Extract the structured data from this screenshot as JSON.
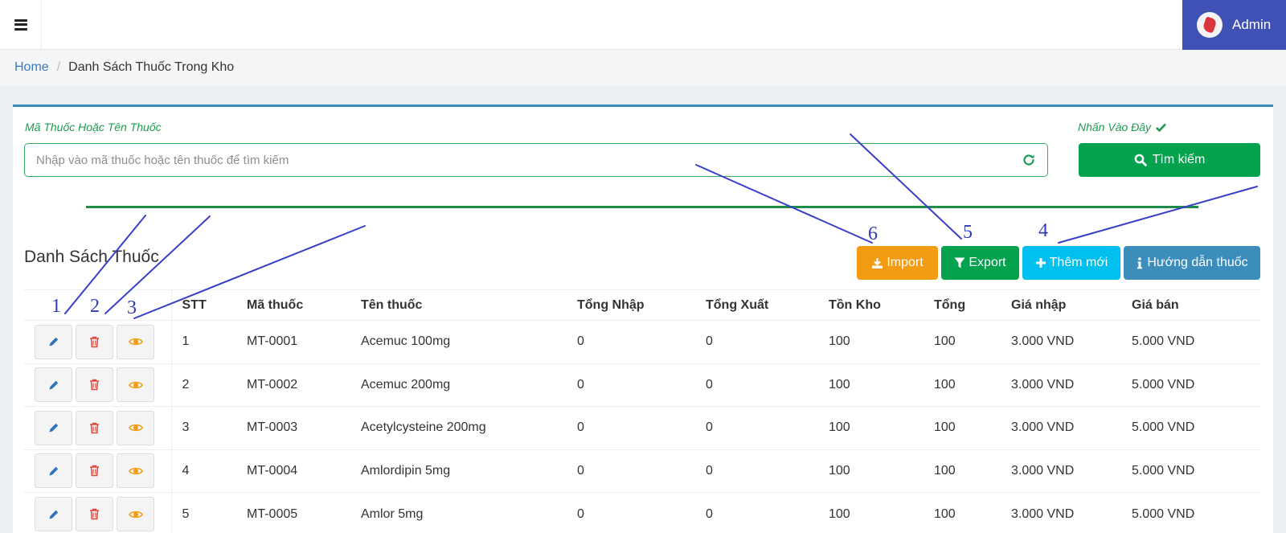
{
  "topbar": {
    "menu_icon": "hamburger-icon",
    "user_name": "Admin"
  },
  "breadcrumb": {
    "home": "Home",
    "current": "Danh Sách Thuốc Trong Kho"
  },
  "search": {
    "label": "Mã Thuốc Hoặc Tên Thuốc",
    "placeholder": "Nhập vào mã thuốc hoặc tên thuốc để tìm kiếm",
    "value": "",
    "click_label": "Nhấn Vào Đây",
    "button_label": "Tìm kiếm"
  },
  "list": {
    "title": "Danh Sách Thuốc",
    "buttons": {
      "import": "Import",
      "export": "Export",
      "add": "Thêm mới",
      "guide": "Hướng dẫn thuốc"
    },
    "columns": [
      "",
      "STT",
      "Mã thuốc",
      "Tên thuốc",
      "Tổng Nhập",
      "Tổng Xuất",
      "Tồn Kho",
      "Tổng",
      "Giá nhập",
      "Giá bán"
    ],
    "rows": [
      [
        "1",
        "MT-0001",
        "Acemuc 100mg",
        "0",
        "0",
        "100",
        "100",
        "3.000 VND",
        "5.000 VND"
      ],
      [
        "2",
        "MT-0002",
        "Acemuc 200mg",
        "0",
        "0",
        "100",
        "100",
        "3.000 VND",
        "5.000 VND"
      ],
      [
        "3",
        "MT-0003",
        "Acetylcysteine 200mg",
        "0",
        "0",
        "100",
        "100",
        "3.000 VND",
        "5.000 VND"
      ],
      [
        "4",
        "MT-0004",
        "Amlordipin 5mg",
        "0",
        "0",
        "100",
        "100",
        "3.000 VND",
        "5.000 VND"
      ],
      [
        "5",
        "MT-0005",
        "Amlor 5mg",
        "0",
        "0",
        "100",
        "100",
        "3.000 VND",
        "5.000 VND"
      ]
    ]
  },
  "annotations": [
    "1",
    "2",
    "3",
    "4",
    "5",
    "6"
  ],
  "colors": {
    "user_bg": "#3f51b5",
    "card_border": "#3c8dbc",
    "search_green": "#05a24d",
    "import": "#f39c12",
    "export": "#05a24d",
    "add": "#00c0ef",
    "guide": "#3c8dbc",
    "annotation": "#2f3bb5"
  }
}
